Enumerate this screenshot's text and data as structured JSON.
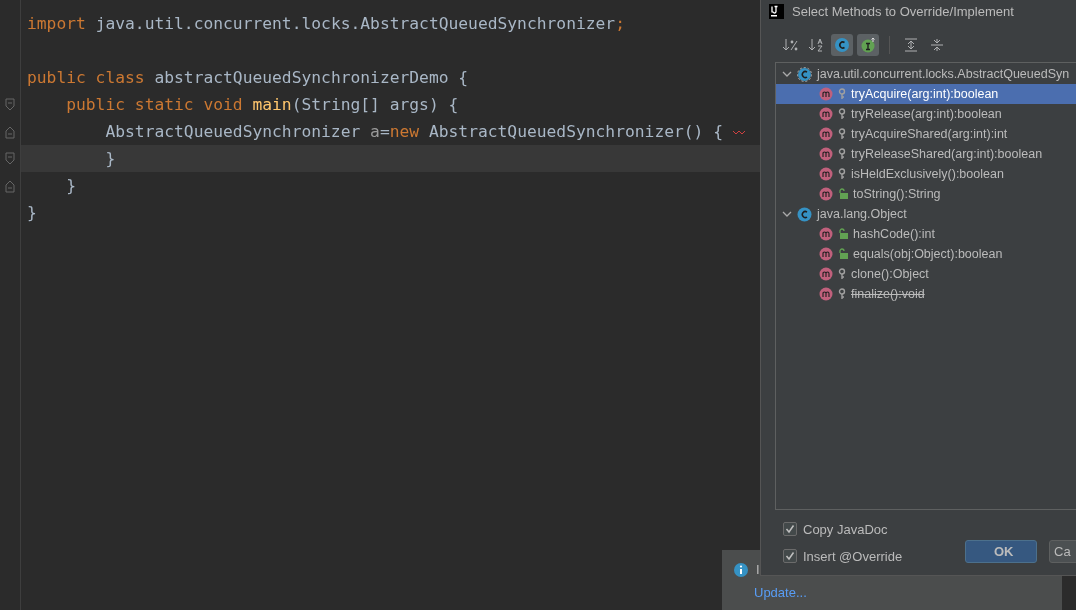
{
  "editor": {
    "lines": [
      {
        "current": false,
        "kind": "plain",
        "tokens": [
          {
            "text": "import",
            "kind": "keyword"
          },
          {
            "text": " java.util.concurrent.locks.AbstractQueuedSynchronizer",
            "kind": "plain"
          },
          {
            "text": ";",
            "kind": "keyword"
          }
        ]
      },
      {
        "current": false,
        "kind": "plain"
      },
      {
        "current": false,
        "kind": "plain",
        "tokens": [
          {
            "text": "public class",
            "kind": "keyword"
          },
          {
            "text": " abstractQueuedSynchronizerDemo {",
            "kind": "plain"
          }
        ]
      },
      {
        "current": false,
        "kind": "fold-start",
        "tokens": [
          {
            "text": "    public static void ",
            "kind": "keyword"
          },
          {
            "text": "main",
            "kind": "method"
          },
          {
            "text": "(String[] args) {",
            "kind": "plain"
          }
        ]
      },
      {
        "current": false,
        "kind": "fold-end",
        "error": true,
        "tokens": [
          {
            "text": "        AbstractQueuedSynchronizer ",
            "kind": "plain"
          },
          {
            "text": "a",
            "kind": "local"
          },
          {
            "text": "=",
            "kind": "plain"
          },
          {
            "text": "new",
            "kind": "keyword"
          },
          {
            "text": " AbstractQueuedSynchronizer() {",
            "kind": "plain"
          }
        ]
      },
      {
        "current": true,
        "kind": "fold-start",
        "tokens": [
          {
            "text": "        }",
            "kind": "plain"
          }
        ]
      },
      {
        "current": false,
        "kind": "fold-end",
        "tokens": [
          {
            "text": "    }",
            "kind": "plain"
          }
        ]
      },
      {
        "current": false,
        "kind": "plain",
        "tokens": [
          {
            "text": "}",
            "kind": "plain"
          }
        ]
      }
    ]
  },
  "notification": {
    "title": "I",
    "link": "Update..."
  },
  "dialog": {
    "title": "Select Methods to Override/Implement",
    "toolbar": [
      {
        "kind": "sort-visibility",
        "selected": false
      },
      {
        "kind": "sort-alpha",
        "selected": false
      },
      {
        "kind": "show-classes",
        "selected": true
      },
      {
        "kind": "show-interfaces",
        "selected": true
      },
      {
        "kind": "expand-all",
        "selected": false
      },
      {
        "kind": "collapse-all",
        "selected": false
      }
    ],
    "tree": [
      {
        "label": "java.util.concurrent.locks.AbstractQueuedSyn",
        "expanded": true,
        "kind": "abstract-class",
        "children": [
          {
            "label": "tryAcquire(arg:int):boolean",
            "kind": "protected",
            "deprecated": false,
            "selected": true
          },
          {
            "label": "tryRelease(arg:int):boolean",
            "kind": "protected",
            "deprecated": false,
            "selected": false
          },
          {
            "label": "tryAcquireShared(arg:int):int",
            "kind": "protected",
            "deprecated": false,
            "selected": false
          },
          {
            "label": "tryReleaseShared(arg:int):boolean",
            "kind": "protected",
            "deprecated": false,
            "selected": false
          },
          {
            "label": "isHeldExclusively():boolean",
            "kind": "protected",
            "deprecated": false,
            "selected": false
          },
          {
            "label": "toString():String",
            "kind": "public",
            "deprecated": false,
            "selected": false
          }
        ]
      },
      {
        "label": "java.lang.Object",
        "expanded": true,
        "kind": "class",
        "children": [
          {
            "label": "hashCode():int",
            "kind": "public",
            "deprecated": false,
            "selected": false
          },
          {
            "label": "equals(obj:Object):boolean",
            "kind": "public",
            "deprecated": false,
            "selected": false
          },
          {
            "label": "clone():Object",
            "kind": "protected",
            "deprecated": false,
            "selected": false
          },
          {
            "label": "finalize():void",
            "kind": "protected",
            "deprecated": true,
            "selected": false
          }
        ]
      }
    ],
    "options": [
      {
        "label": "Copy JavaDoc",
        "checked": true
      },
      {
        "label": "Insert @Override",
        "checked": true
      }
    ],
    "buttons": [
      {
        "label": "OK",
        "kind": "default"
      },
      {
        "label": "Ca",
        "kind": "normal"
      }
    ]
  }
}
